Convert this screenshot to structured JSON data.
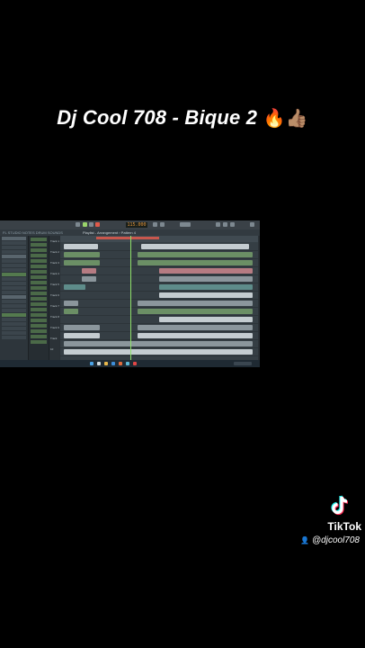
{
  "video": {
    "caption": "Dj Cool 708 - Bique 2",
    "caption_emojis": "🔥👍🏽"
  },
  "screenshot": {
    "app": "FL Studio",
    "tempo_display": "115.000",
    "toolbar_hint": "FL STUDIO NOTES DRUM SOUNDS",
    "playlist_title": "Playlist - Arrangement › Pattern 4",
    "track_labels": [
      "Track 1",
      "Track 2",
      "Track 3",
      "Track 4",
      "Track 5",
      "Track 6",
      "Track 7",
      "Track 8",
      "Track 9",
      "Track 10"
    ]
  },
  "watermark": {
    "brand": "TikTok",
    "username": "@djcool708",
    "person_icon": "person-icon"
  }
}
